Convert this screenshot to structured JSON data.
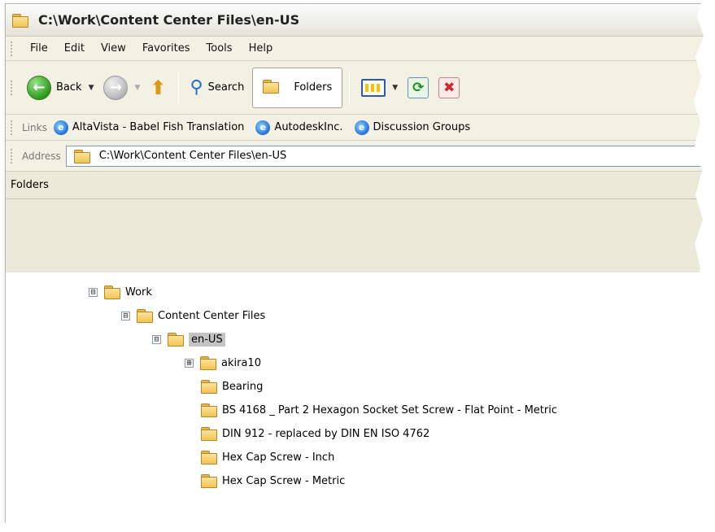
{
  "window": {
    "title": "C:\\Work\\Content Center Files\\en-US",
    "title_icon": "folder-window-icon"
  },
  "menubar": {
    "items": [
      "File",
      "Edit",
      "View",
      "Favorites",
      "Tools",
      "Help"
    ]
  },
  "toolbar": {
    "back_label": "Back",
    "search_label": "Search",
    "folders_label": "Folders"
  },
  "links": {
    "label": "Links",
    "items": [
      "AltaVista - Babel Fish Translation",
      "AutodeskInc.",
      "Discussion Groups"
    ]
  },
  "address": {
    "label": "Address",
    "value": "C:\\Work\\Content Center Files\\en-US"
  },
  "folders_pane": {
    "header": "Folders",
    "tree": [
      {
        "label": "Work",
        "toggle": "⊟"
      },
      {
        "label": "Content Center Files",
        "toggle": "⊟"
      },
      {
        "label": "en-US",
        "toggle": "⊟",
        "selected": true
      },
      {
        "label": "akira10",
        "toggle": "⊞"
      },
      {
        "label": "Bearing",
        "toggle": ""
      },
      {
        "label": "BS 4168 _ Part 2 Hexagon Socket Set Screw - Flat Point - Metric",
        "toggle": ""
      },
      {
        "label": "DIN 912 - replaced by DIN EN ISO 4762",
        "toggle": ""
      },
      {
        "label": "Hex Cap Screw - Inch",
        "toggle": ""
      },
      {
        "label": "Hex Cap Screw - Metric",
        "toggle": ""
      }
    ]
  },
  "colors": {
    "window_bg": "#ece9d8",
    "selection": "#c4c4c4",
    "folder_yellow": "#f1c453"
  }
}
